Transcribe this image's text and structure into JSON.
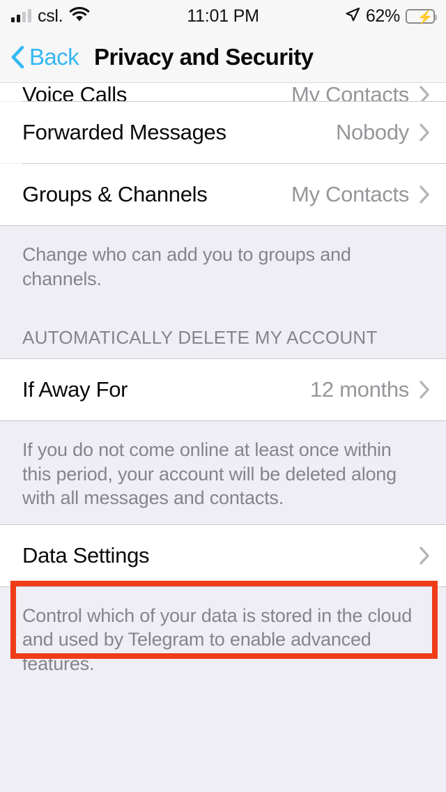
{
  "status_bar": {
    "carrier": "csl.",
    "time": "11:01 PM",
    "battery_percent": "62%",
    "battery_level": 62,
    "signal_bars_filled": 2,
    "signal_bars_total": 4,
    "wifi_icon": "wifi-icon",
    "location_icon": "location-arrow-icon",
    "charging_icon": "bolt-icon"
  },
  "nav": {
    "back_label": "Back",
    "back_icon": "chevron-left-icon",
    "title": "Privacy and Security"
  },
  "sections": [
    {
      "rows": [
        {
          "title": "Voice Calls",
          "value": "My Contacts",
          "clipped": true
        },
        {
          "title": "Forwarded Messages",
          "value": "Nobody",
          "clipped": false
        },
        {
          "title": "Groups & Channels",
          "value": "My Contacts",
          "clipped": false
        }
      ],
      "footer": "Change who can add you to groups and channels."
    },
    {
      "header": "AUTOMATICALLY DELETE MY ACCOUNT",
      "rows": [
        {
          "title": "If Away For",
          "value": "12 months",
          "clipped": false
        }
      ],
      "footer": "If you do not come online at least once within this period, your account will be deleted along with all messages and contacts."
    },
    {
      "rows": [
        {
          "title": "Data Settings",
          "value": "",
          "clipped": false,
          "highlighted": true
        }
      ],
      "footer": "Control which of your data is stored in the cloud and used by Telegram to enable advanced features."
    }
  ],
  "colors": {
    "accent_blue": "#34B8F1",
    "annotation_red": "#F03C18",
    "group_background": "#EFEEF4",
    "cell_background": "#FFFFFF",
    "secondary_text": "#96969B",
    "battery_green": "#35C759"
  }
}
